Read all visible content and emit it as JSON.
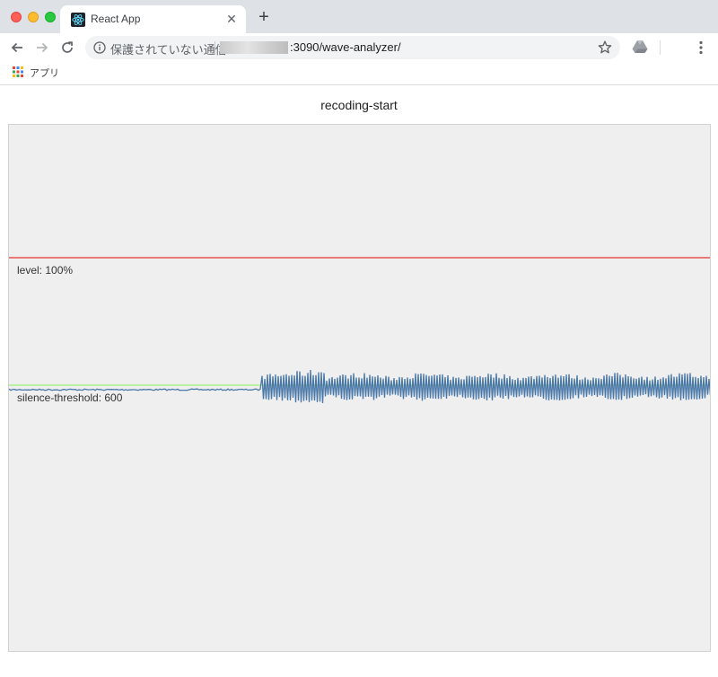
{
  "browser": {
    "tab_title": "React App",
    "tab_close_glyph": "✕",
    "new_tab_glyph": "+",
    "address_security_text": "保護されていない通信",
    "address_url": ":3090/wave-analyzer/",
    "bookmarks": [
      {
        "label": "アプリ",
        "icon": "apps-grid-icon"
      }
    ],
    "icons": [
      "back-arrow-icon",
      "forward-arrow-icon",
      "reload-icon",
      "info-icon",
      "bookmark-star-icon",
      "google-drive-icon",
      "kebab-menu-icon",
      "react-logo-icon"
    ]
  },
  "page": {
    "heading": "recoding-start"
  },
  "analyzer": {
    "level_label": "level: 100%",
    "silence_label": "silence-threshold: 600",
    "colors": {
      "canvas_background": "#efefef",
      "level_line": "#e8312f",
      "silence_line": "#a8f08a",
      "waveform": "#4a78a8"
    }
  }
}
